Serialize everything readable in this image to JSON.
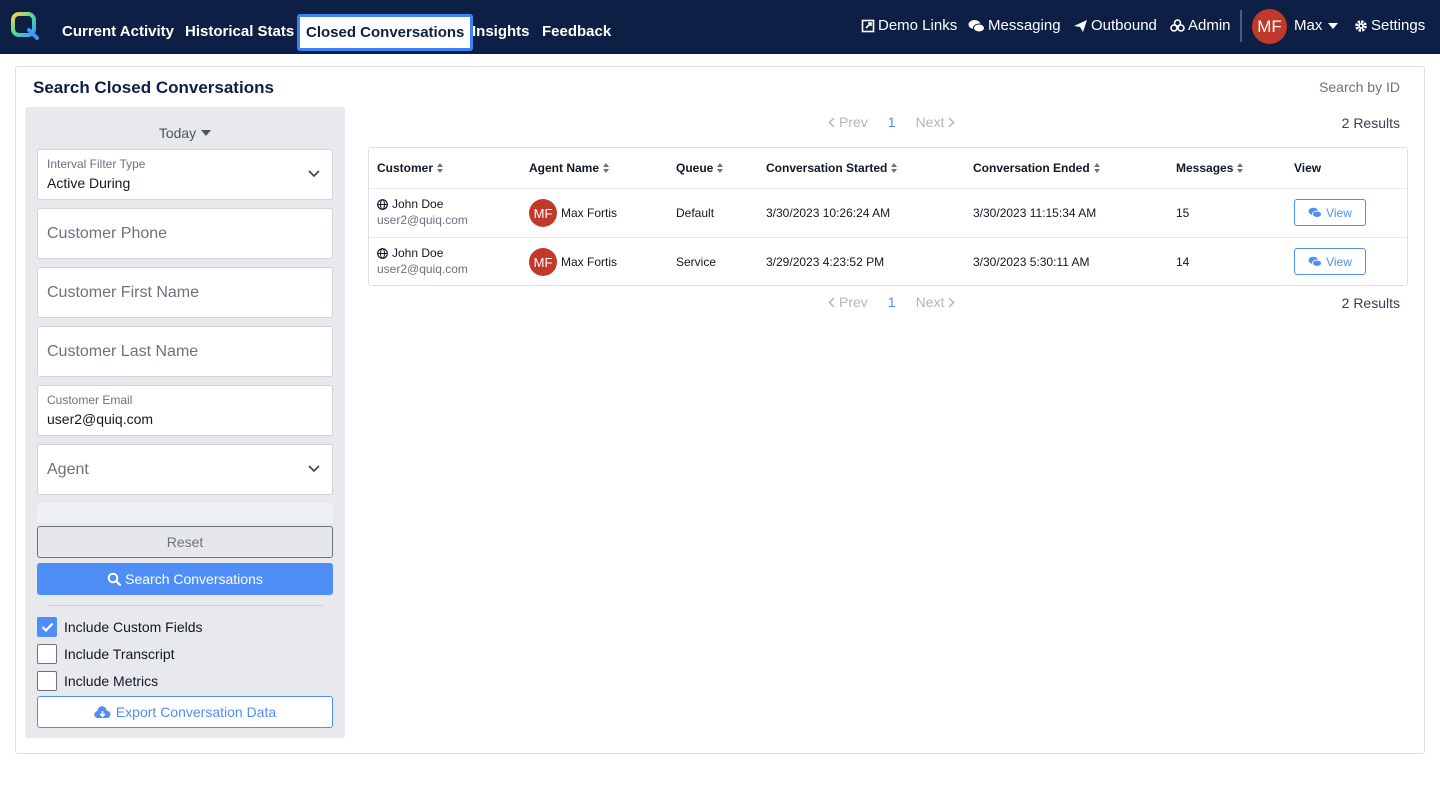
{
  "nav": {
    "tabs": [
      {
        "label": "Current Activity"
      },
      {
        "label": "Historical Stats"
      },
      {
        "label": "Closed Conversations"
      },
      {
        "label": "Insights"
      },
      {
        "label": "Feedback"
      }
    ],
    "right_links": [
      {
        "label": "Demo Links",
        "icon": "external-link-icon"
      },
      {
        "label": "Messaging",
        "icon": "chat-bubbles-icon"
      },
      {
        "label": "Outbound",
        "icon": "paper-plane-icon"
      },
      {
        "label": "Admin",
        "icon": "users-icon"
      }
    ],
    "user_initials": "MF",
    "user_name": "Max",
    "settings_label": "Settings",
    "colors": {
      "bar": "#0e1f45",
      "accent": "#3b82f6",
      "avatar": "#c0392b"
    }
  },
  "page": {
    "title": "Search Closed Conversations",
    "search_by_id": "Search by ID"
  },
  "filters": {
    "date_range": "Today",
    "interval_filter": {
      "label": "Interval Filter Type",
      "value": "Active During"
    },
    "customer_phone": {
      "placeholder": "Customer Phone"
    },
    "customer_first_name": {
      "placeholder": "Customer First Name"
    },
    "customer_last_name": {
      "placeholder": "Customer Last Name"
    },
    "customer_email": {
      "label": "Customer Email",
      "value": "user2@quiq.com"
    },
    "agent": {
      "placeholder": "Agent"
    },
    "reset_label": "Reset",
    "search_label": "Search Conversations",
    "checkboxes": [
      {
        "label": "Include Custom Fields",
        "checked": true
      },
      {
        "label": "Include Transcript",
        "checked": false
      },
      {
        "label": "Include Metrics",
        "checked": false
      }
    ],
    "export_label": "Export Conversation Data"
  },
  "pagination": {
    "prev_label": "Prev",
    "page": "1",
    "next_label": "Next",
    "results_label": "2 Results"
  },
  "table": {
    "columns": [
      "Customer",
      "Agent Name",
      "Queue",
      "Conversation Started",
      "Conversation Ended",
      "Messages",
      "View"
    ],
    "rows": [
      {
        "customer_name": "John Doe",
        "customer_email": "user2@quiq.com",
        "agent_initials": "MF",
        "agent_name": "Max Fortis",
        "queue": "Default",
        "started": "3/30/2023 10:26:24 AM",
        "ended": "3/30/2023 11:15:34 AM",
        "messages": "15",
        "view_label": "View"
      },
      {
        "customer_name": "John Doe",
        "customer_email": "user2@quiq.com",
        "agent_initials": "MF",
        "agent_name": "Max Fortis",
        "queue": "Service",
        "started": "3/29/2023 4:23:52 PM",
        "ended": "3/30/2023 5:30:11 AM",
        "messages": "14",
        "view_label": "View"
      }
    ]
  }
}
